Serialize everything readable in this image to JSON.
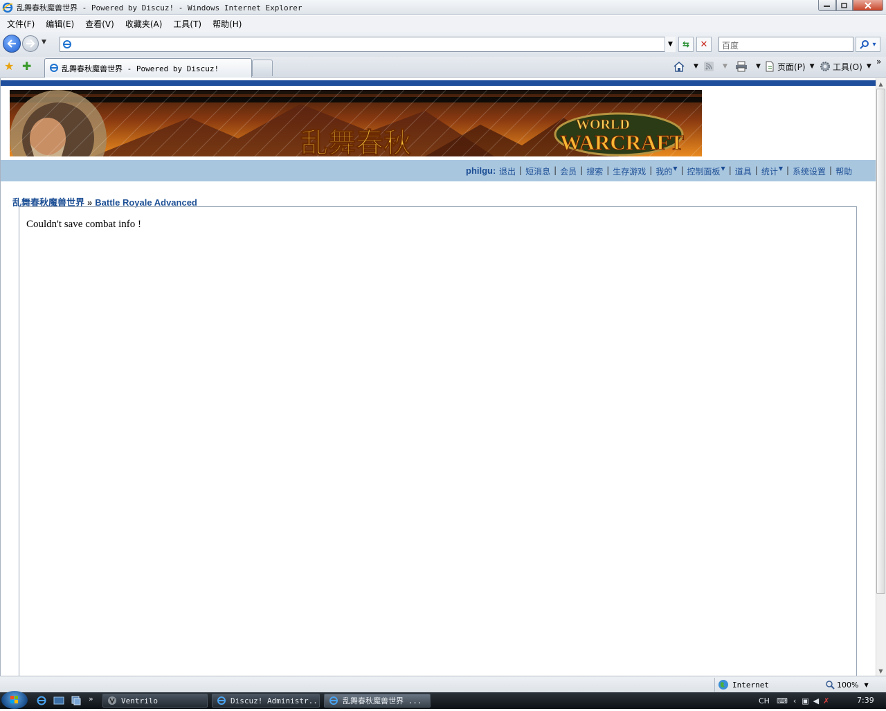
{
  "window": {
    "title": "乱舞春秋魔兽世界 - Powered by Discuz! - Windows Internet Explorer"
  },
  "menu": [
    "文件(F)",
    "编辑(E)",
    "查看(V)",
    "收藏夹(A)",
    "工具(T)",
    "帮助(H)"
  ],
  "address": {
    "url": "",
    "search_placeholder": "百度"
  },
  "tabs": {
    "active_label": "乱舞春秋魔兽世界 - Powered by Discuz!"
  },
  "commands": {
    "page": "页面(P)",
    "tools": "工具(O)",
    "more": "»"
  },
  "site": {
    "username": "philgu:",
    "nav_links": [
      {
        "label": "退出",
        "dropdown": false
      },
      {
        "label": "短消息",
        "dropdown": false
      },
      {
        "label": "会员",
        "dropdown": false
      },
      {
        "label": "搜索",
        "dropdown": false
      },
      {
        "label": "生存游戏",
        "dropdown": false
      },
      {
        "label": "我的",
        "dropdown": true
      },
      {
        "label": "控制面板",
        "dropdown": true
      },
      {
        "label": "道具",
        "dropdown": false
      },
      {
        "label": "统计",
        "dropdown": true
      },
      {
        "label": "系统设置",
        "dropdown": false
      },
      {
        "label": "帮助",
        "dropdown": false
      }
    ],
    "breadcrumb": {
      "home": "乱舞春秋魔兽世界",
      "arrow": "»",
      "current": "Battle Royale Advanced"
    },
    "message": "Couldn't save combat info !",
    "banner": {
      "left_text": "乱舞春秋",
      "logo_top": "WORLD",
      "logo_main": "WARCRAFT"
    }
  },
  "statusbar": {
    "zone": "Internet",
    "zoom": "100%"
  },
  "taskbar": {
    "tasks": [
      "Ventrilo",
      "Discuz! Administr...",
      "乱舞春秋魔兽世界 ..."
    ],
    "tray_lang": "CH",
    "clock": "7:39"
  },
  "colors": {
    "header_stripe": "#1f4e9c",
    "nav_bg": "#a9c6df",
    "link": "#1d4f95"
  }
}
